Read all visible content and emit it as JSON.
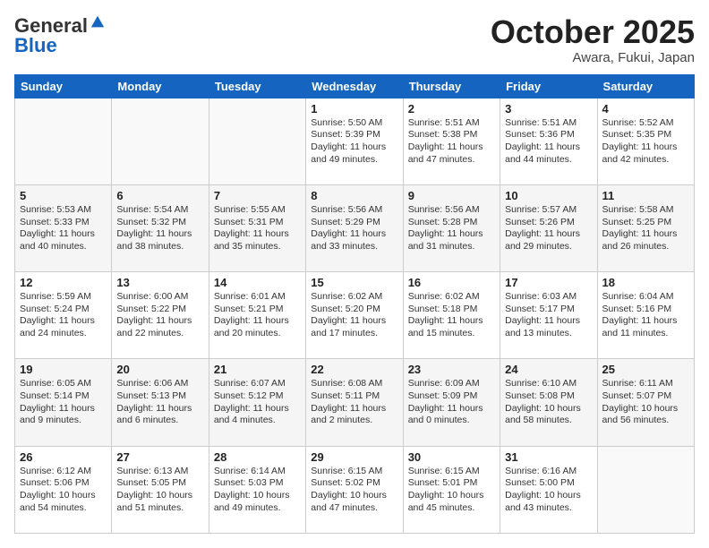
{
  "header": {
    "logo_line1": "General",
    "logo_line2": "Blue",
    "month": "October 2025",
    "location": "Awara, Fukui, Japan"
  },
  "days_of_week": [
    "Sunday",
    "Monday",
    "Tuesday",
    "Wednesday",
    "Thursday",
    "Friday",
    "Saturday"
  ],
  "weeks": [
    [
      {
        "day": "",
        "text": ""
      },
      {
        "day": "",
        "text": ""
      },
      {
        "day": "",
        "text": ""
      },
      {
        "day": "1",
        "text": "Sunrise: 5:50 AM\nSunset: 5:39 PM\nDaylight: 11 hours\nand 49 minutes."
      },
      {
        "day": "2",
        "text": "Sunrise: 5:51 AM\nSunset: 5:38 PM\nDaylight: 11 hours\nand 47 minutes."
      },
      {
        "day": "3",
        "text": "Sunrise: 5:51 AM\nSunset: 5:36 PM\nDaylight: 11 hours\nand 44 minutes."
      },
      {
        "day": "4",
        "text": "Sunrise: 5:52 AM\nSunset: 5:35 PM\nDaylight: 11 hours\nand 42 minutes."
      }
    ],
    [
      {
        "day": "5",
        "text": "Sunrise: 5:53 AM\nSunset: 5:33 PM\nDaylight: 11 hours\nand 40 minutes."
      },
      {
        "day": "6",
        "text": "Sunrise: 5:54 AM\nSunset: 5:32 PM\nDaylight: 11 hours\nand 38 minutes."
      },
      {
        "day": "7",
        "text": "Sunrise: 5:55 AM\nSunset: 5:31 PM\nDaylight: 11 hours\nand 35 minutes."
      },
      {
        "day": "8",
        "text": "Sunrise: 5:56 AM\nSunset: 5:29 PM\nDaylight: 11 hours\nand 33 minutes."
      },
      {
        "day": "9",
        "text": "Sunrise: 5:56 AM\nSunset: 5:28 PM\nDaylight: 11 hours\nand 31 minutes."
      },
      {
        "day": "10",
        "text": "Sunrise: 5:57 AM\nSunset: 5:26 PM\nDaylight: 11 hours\nand 29 minutes."
      },
      {
        "day": "11",
        "text": "Sunrise: 5:58 AM\nSunset: 5:25 PM\nDaylight: 11 hours\nand 26 minutes."
      }
    ],
    [
      {
        "day": "12",
        "text": "Sunrise: 5:59 AM\nSunset: 5:24 PM\nDaylight: 11 hours\nand 24 minutes."
      },
      {
        "day": "13",
        "text": "Sunrise: 6:00 AM\nSunset: 5:22 PM\nDaylight: 11 hours\nand 22 minutes."
      },
      {
        "day": "14",
        "text": "Sunrise: 6:01 AM\nSunset: 5:21 PM\nDaylight: 11 hours\nand 20 minutes."
      },
      {
        "day": "15",
        "text": "Sunrise: 6:02 AM\nSunset: 5:20 PM\nDaylight: 11 hours\nand 17 minutes."
      },
      {
        "day": "16",
        "text": "Sunrise: 6:02 AM\nSunset: 5:18 PM\nDaylight: 11 hours\nand 15 minutes."
      },
      {
        "day": "17",
        "text": "Sunrise: 6:03 AM\nSunset: 5:17 PM\nDaylight: 11 hours\nand 13 minutes."
      },
      {
        "day": "18",
        "text": "Sunrise: 6:04 AM\nSunset: 5:16 PM\nDaylight: 11 hours\nand 11 minutes."
      }
    ],
    [
      {
        "day": "19",
        "text": "Sunrise: 6:05 AM\nSunset: 5:14 PM\nDaylight: 11 hours\nand 9 minutes."
      },
      {
        "day": "20",
        "text": "Sunrise: 6:06 AM\nSunset: 5:13 PM\nDaylight: 11 hours\nand 6 minutes."
      },
      {
        "day": "21",
        "text": "Sunrise: 6:07 AM\nSunset: 5:12 PM\nDaylight: 11 hours\nand 4 minutes."
      },
      {
        "day": "22",
        "text": "Sunrise: 6:08 AM\nSunset: 5:11 PM\nDaylight: 11 hours\nand 2 minutes."
      },
      {
        "day": "23",
        "text": "Sunrise: 6:09 AM\nSunset: 5:09 PM\nDaylight: 11 hours\nand 0 minutes."
      },
      {
        "day": "24",
        "text": "Sunrise: 6:10 AM\nSunset: 5:08 PM\nDaylight: 10 hours\nand 58 minutes."
      },
      {
        "day": "25",
        "text": "Sunrise: 6:11 AM\nSunset: 5:07 PM\nDaylight: 10 hours\nand 56 minutes."
      }
    ],
    [
      {
        "day": "26",
        "text": "Sunrise: 6:12 AM\nSunset: 5:06 PM\nDaylight: 10 hours\nand 54 minutes."
      },
      {
        "day": "27",
        "text": "Sunrise: 6:13 AM\nSunset: 5:05 PM\nDaylight: 10 hours\nand 51 minutes."
      },
      {
        "day": "28",
        "text": "Sunrise: 6:14 AM\nSunset: 5:03 PM\nDaylight: 10 hours\nand 49 minutes."
      },
      {
        "day": "29",
        "text": "Sunrise: 6:15 AM\nSunset: 5:02 PM\nDaylight: 10 hours\nand 47 minutes."
      },
      {
        "day": "30",
        "text": "Sunrise: 6:15 AM\nSunset: 5:01 PM\nDaylight: 10 hours\nand 45 minutes."
      },
      {
        "day": "31",
        "text": "Sunrise: 6:16 AM\nSunset: 5:00 PM\nDaylight: 10 hours\nand 43 minutes."
      },
      {
        "day": "",
        "text": ""
      }
    ]
  ]
}
